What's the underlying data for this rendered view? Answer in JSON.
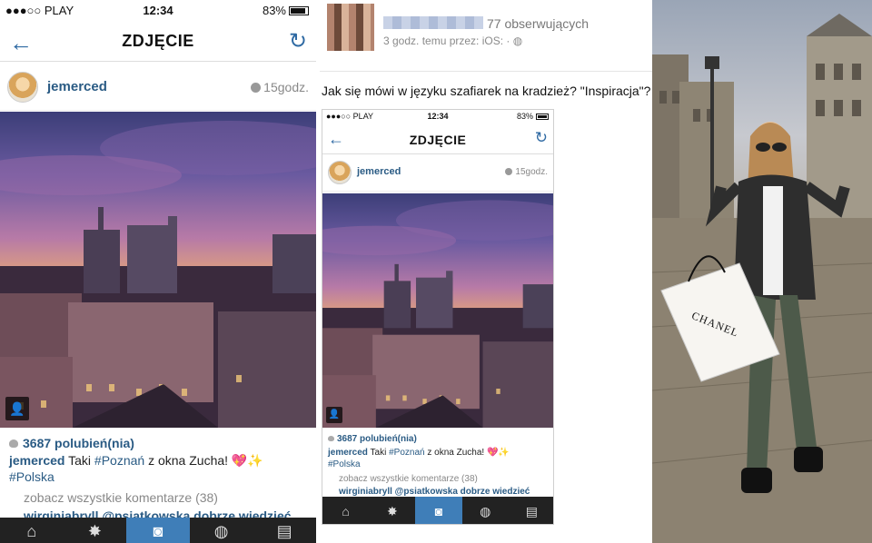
{
  "status_bar": {
    "carrier": "●●●○○ PLAY",
    "time": "12:34",
    "battery": "83%"
  },
  "instagram": {
    "screen_title": "ZDJĘCIE",
    "username": "jemerced",
    "time_ago": "15godz.",
    "likes": "3687 polubień(nia)",
    "caption_user": "jemerced",
    "caption_text": "Taki ",
    "caption_tag1": "#Poznań",
    "caption_rest": " z okna Zucha! 💖✨",
    "caption_tag2": "#Polska",
    "see_all_comments": "zobacz wszystkie komentarze (38)",
    "comment_preview": "wirginiabryll @psiatkowska dobrze wiedzieć",
    "tabs": [
      {
        "icon": "home-icon",
        "glyph": "⌂"
      },
      {
        "icon": "explore-star-icon",
        "glyph": "✸"
      },
      {
        "icon": "camera-icon",
        "glyph": "◙"
      },
      {
        "icon": "activity-bubble-icon",
        "glyph": "◍"
      },
      {
        "icon": "profile-card-icon",
        "glyph": "▤"
      }
    ]
  },
  "facebook": {
    "followers": "77 obserwujących",
    "meta": "3 godz. temu przez: iOS: · ◍",
    "post_text": "Jak się mówi w języku szafiarek na kradzież? \"Inspiracja\"?"
  },
  "photo": {
    "bag_brand": "CHANEL"
  },
  "colors": {
    "ig_blue": "#2a5b84",
    "ig_tab_active": "#3f7eb8",
    "tabbar": "#222222"
  }
}
